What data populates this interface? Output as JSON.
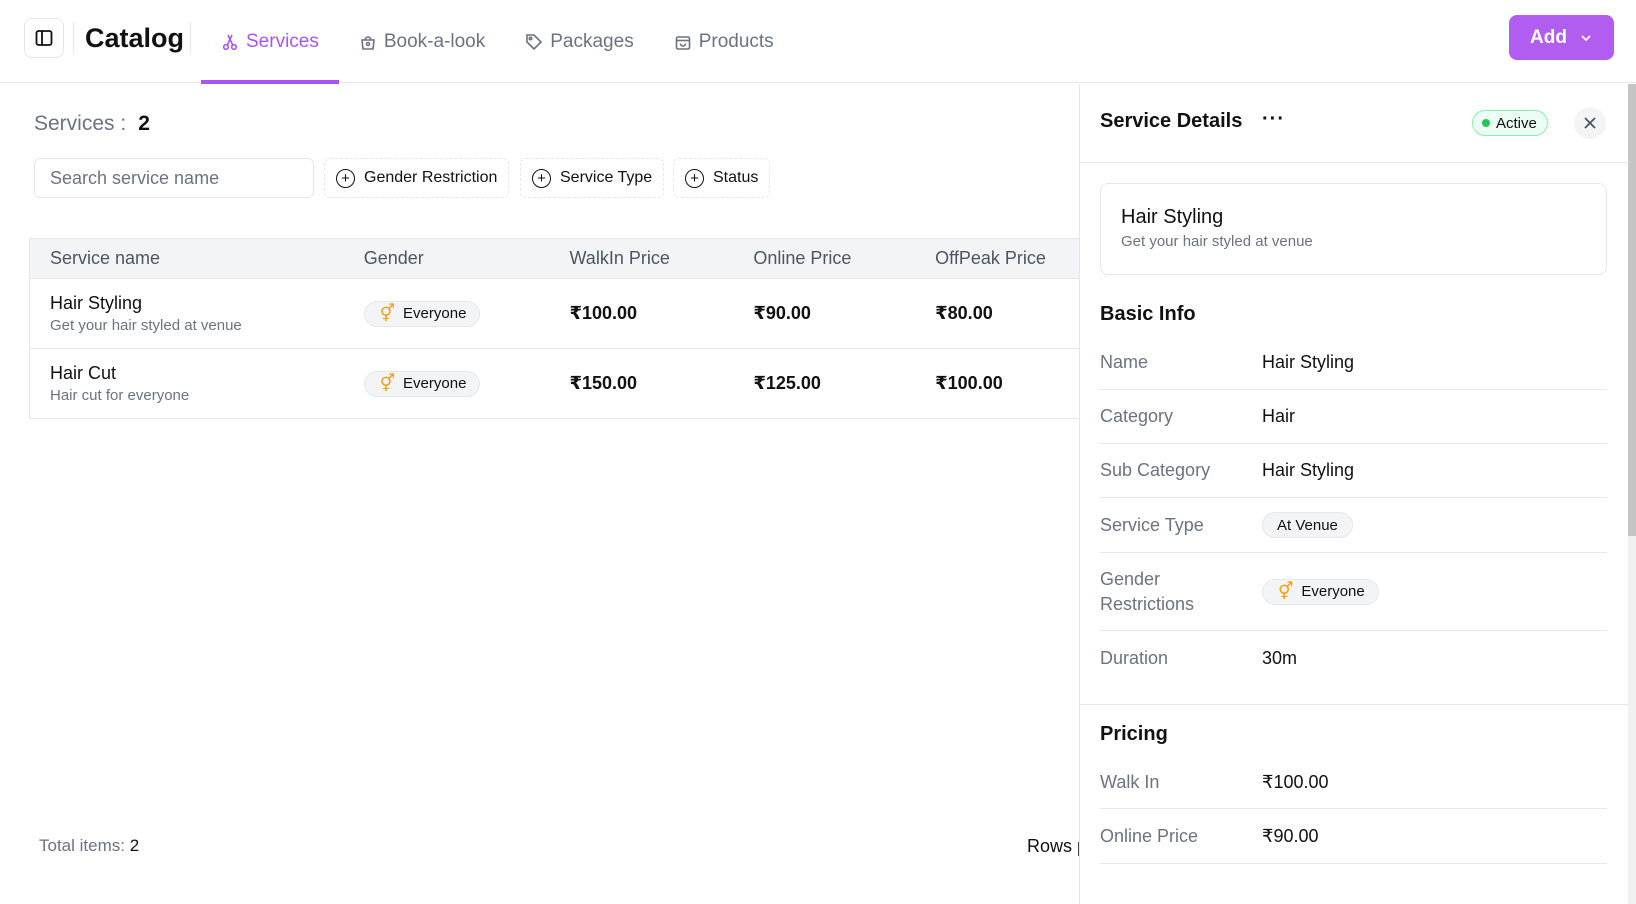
{
  "header": {
    "title": "Catalog",
    "tabs": [
      {
        "label": "Services",
        "icon": "scissors-icon",
        "active": true
      },
      {
        "label": "Book-a-look",
        "icon": "bag-icon",
        "active": false
      },
      {
        "label": "Packages",
        "icon": "tag-icon",
        "active": false
      },
      {
        "label": "Products",
        "icon": "box-icon",
        "active": false
      }
    ],
    "add_label": "Add"
  },
  "services": {
    "count_label": "Services :",
    "count": "2",
    "search_placeholder": "Search service name",
    "filters": [
      "Gender Restriction",
      "Service Type",
      "Status"
    ],
    "columns": [
      "Service name",
      "Gender",
      "WalkIn Price",
      "Online Price",
      "OffPeak Price"
    ],
    "rows": [
      {
        "name": "Hair Styling",
        "desc": "Get your hair styled at venue",
        "gender": "Everyone",
        "walkin": "₹100.00",
        "online": "₹90.00",
        "offpeak": "₹80.00"
      },
      {
        "name": "Hair Cut",
        "desc": "Hair cut for everyone",
        "gender": "Everyone",
        "walkin": "₹150.00",
        "online": "₹125.00",
        "offpeak": "₹100.00"
      }
    ],
    "total_label": "Total items:",
    "total": "2",
    "rows_per_page": "Rows per page"
  },
  "details": {
    "title": "Service Details",
    "status": "Active",
    "card_title": "Hair Styling",
    "card_desc": "Get your hair styled at venue",
    "basic_info_title": "Basic Info",
    "basic": {
      "name_label": "Name",
      "name": "Hair Styling",
      "category_label": "Category",
      "category": "Hair",
      "subcategory_label": "Sub Category",
      "subcategory": "Hair Styling",
      "type_label": "Service Type",
      "type": "At Venue",
      "gender_label_1": "Gender",
      "gender_label_2": "Restrictions",
      "gender": "Everyone",
      "duration_label": "Duration",
      "duration": "30m"
    },
    "pricing_title": "Pricing",
    "pricing": {
      "walkin_label": "Walk In",
      "walkin": "₹100.00",
      "online_label": "Online Price",
      "online": "₹90.00"
    }
  },
  "colors": {
    "accent": "#a855f7",
    "add_button": "#b15ef0",
    "active_green": "#22c55e",
    "gender_icon": "#f59e0b"
  }
}
